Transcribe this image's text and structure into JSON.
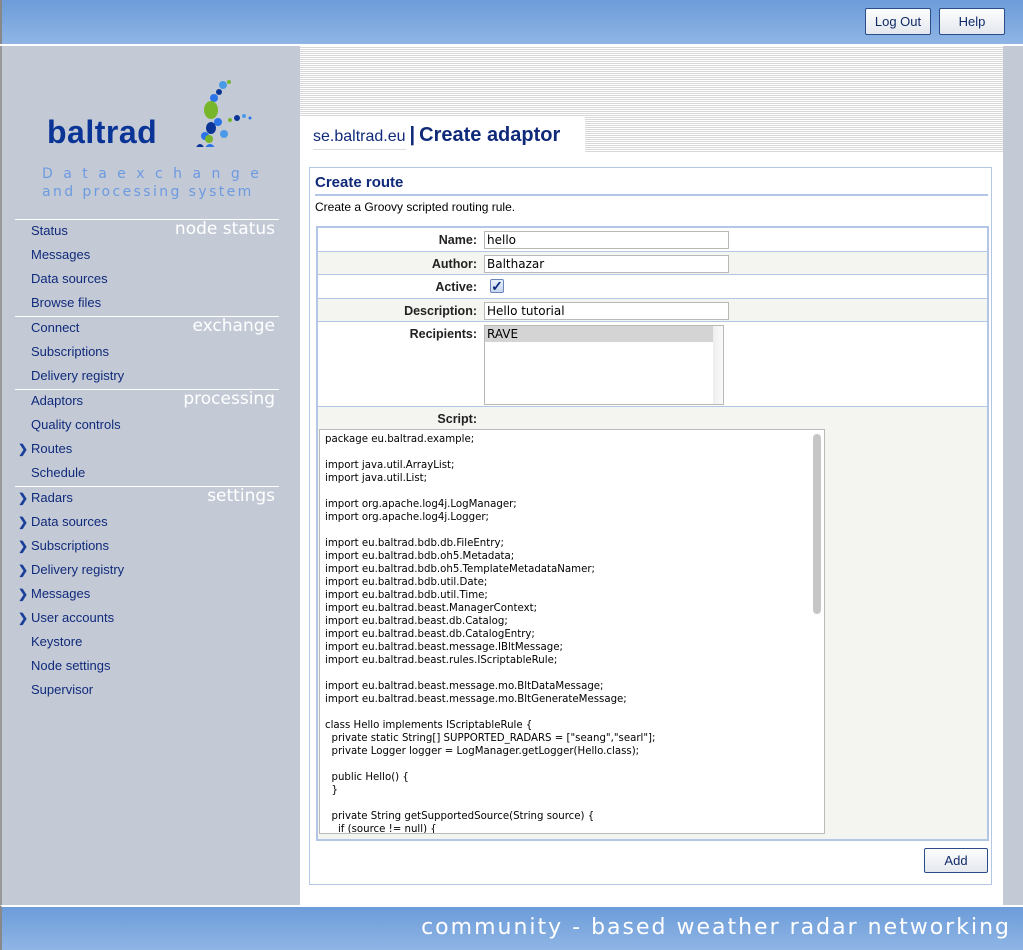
{
  "topbar": {
    "logout": "Log Out",
    "help": "Help"
  },
  "logo": {
    "word": "baltrad",
    "tagline1": "D a t a   e x c h a n g e",
    "tagline2": "and processing system"
  },
  "sidebar": {
    "sections": [
      {
        "title": "node status",
        "items": [
          {
            "label": "Status",
            "arrow": false
          },
          {
            "label": "Messages",
            "arrow": false
          },
          {
            "label": "Data sources",
            "arrow": false
          },
          {
            "label": "Browse files",
            "arrow": false
          }
        ]
      },
      {
        "title": "exchange",
        "items": [
          {
            "label": "Connect",
            "arrow": false
          },
          {
            "label": "Subscriptions",
            "arrow": false
          },
          {
            "label": "Delivery registry",
            "arrow": false
          }
        ]
      },
      {
        "title": "processing",
        "items": [
          {
            "label": "Adaptors",
            "arrow": false
          },
          {
            "label": "Quality controls",
            "arrow": false
          },
          {
            "label": "Routes",
            "arrow": true
          },
          {
            "label": "Schedule",
            "arrow": false
          }
        ]
      },
      {
        "title": "settings",
        "items": [
          {
            "label": "Radars",
            "arrow": true
          },
          {
            "label": "Data sources",
            "arrow": true
          },
          {
            "label": "Subscriptions",
            "arrow": true
          },
          {
            "label": "Delivery registry",
            "arrow": true
          },
          {
            "label": "Messages",
            "arrow": true
          },
          {
            "label": "User accounts",
            "arrow": true
          },
          {
            "label": "Keystore",
            "arrow": false
          },
          {
            "label": "Node settings",
            "arrow": false
          },
          {
            "label": "Supervisor",
            "arrow": false
          }
        ]
      }
    ],
    "arrow_icon": "chevron-right-icon"
  },
  "header": {
    "host": "se.baltrad.eu",
    "separator": "|",
    "page": "Create adaptor"
  },
  "panel": {
    "title": "Create route",
    "description": "Create a Groovy scripted routing rule."
  },
  "form": {
    "name_label": "Name:",
    "name_value": "hello",
    "author_label": "Author:",
    "author_value": "Balthazar",
    "active_label": "Active:",
    "active_checked": true,
    "description_label": "Description:",
    "description_value": "Hello tutorial",
    "recipients_label": "Recipients:",
    "recipients_options": [
      "RAVE"
    ],
    "script_label": "Script:",
    "script_value": "package eu.baltrad.example;\n\nimport java.util.ArrayList;\nimport java.util.List;\n\nimport org.apache.log4j.LogManager;\nimport org.apache.log4j.Logger;\n\nimport eu.baltrad.bdb.db.FileEntry;\nimport eu.baltrad.bdb.oh5.Metadata;\nimport eu.baltrad.bdb.oh5.TemplateMetadataNamer;\nimport eu.baltrad.bdb.util.Date;\nimport eu.baltrad.bdb.util.Time;\nimport eu.baltrad.beast.ManagerContext;\nimport eu.baltrad.beast.db.Catalog;\nimport eu.baltrad.beast.db.CatalogEntry;\nimport eu.baltrad.beast.message.IBltMessage;\nimport eu.baltrad.beast.rules.IScriptableRule;\n\nimport eu.baltrad.beast.message.mo.BltDataMessage;\nimport eu.baltrad.beast.message.mo.BltGenerateMessage;\n\nclass Hello implements IScriptableRule {\n  private static String[] SUPPORTED_RADARS = [\"seang\",\"searl\"];\n  private Logger logger = LogManager.getLogger(Hello.class);\n\n  public Hello() {\n  }\n\n  private String getSupportedSource(String source) {\n    if (source != null) {",
    "add_label": "Add"
  },
  "footer": {
    "text": "community - based weather radar networking"
  },
  "colors": {
    "brand": "#0a3596",
    "link": "#102a7a",
    "bar": "#7aa6df",
    "sidebar": "#c3cad6"
  }
}
